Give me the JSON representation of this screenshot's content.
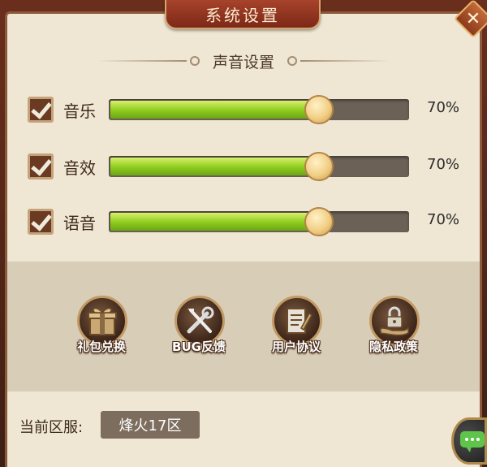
{
  "window": {
    "title": "系统设置",
    "close_icon": "close-icon"
  },
  "sound": {
    "header": "声音设置",
    "rows": [
      {
        "label": "音乐",
        "checked": true,
        "value": 70,
        "percent_text": "70%"
      },
      {
        "label": "音效",
        "checked": true,
        "value": 70,
        "percent_text": "70%"
      },
      {
        "label": "语音",
        "checked": true,
        "value": 70,
        "percent_text": "70%"
      }
    ]
  },
  "actions": [
    {
      "label": "礼包兑换",
      "icon": "gift-icon"
    },
    {
      "label": "BUG反馈",
      "icon": "tools-icon"
    },
    {
      "label": "用户协议",
      "icon": "document-icon"
    },
    {
      "label": "隐私政策",
      "icon": "lock-hand-icon"
    }
  ],
  "server": {
    "label": "当前区服:",
    "value": "烽火17区"
  },
  "colors": {
    "accent": "#8dcb1e",
    "title_bg": "#9a3a24",
    "panel": "#efe6d3"
  },
  "chat_icon": "chat-icon"
}
